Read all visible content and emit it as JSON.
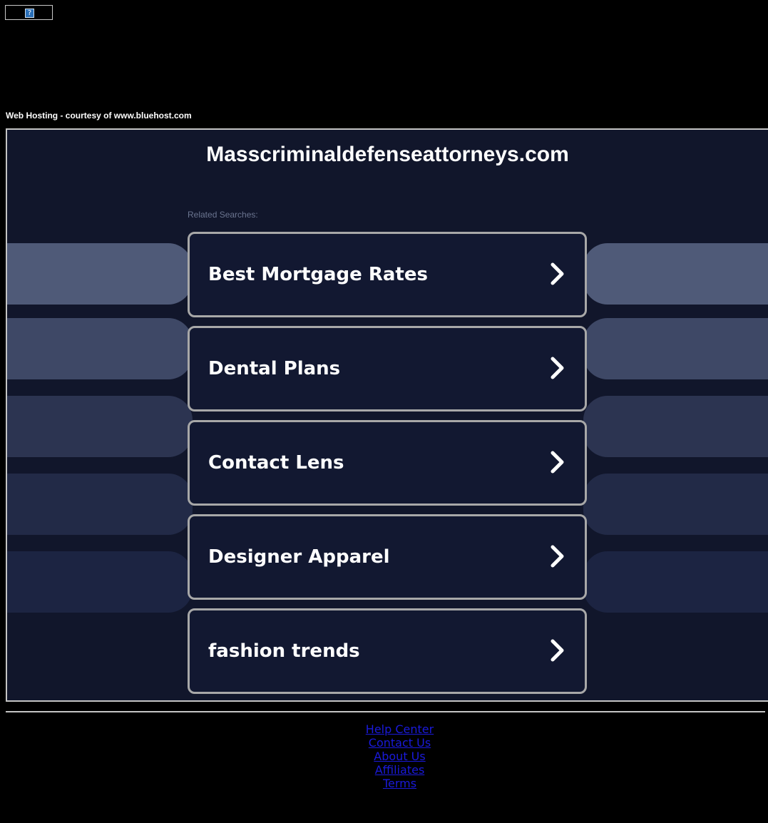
{
  "top_icon": {
    "glyph": "?",
    "name": "broken-image-icon"
  },
  "hosting_text": "Web Hosting - courtesy of www.bluehost.com",
  "site": {
    "title": "Masscriminaldefenseattorneys.com"
  },
  "related_label": "Related Searches:",
  "searches": [
    {
      "label": "Best Mortgage Rates"
    },
    {
      "label": "Dental Plans"
    },
    {
      "label": "Contact Lens"
    },
    {
      "label": "Designer Apparel"
    },
    {
      "label": "fashion trends"
    }
  ],
  "footer_links": [
    {
      "label": "Help Center"
    },
    {
      "label": "Contact Us"
    },
    {
      "label": "About Us"
    },
    {
      "label": "Affiliates"
    },
    {
      "label": "Terms"
    }
  ],
  "colors": {
    "page_bg": "#000000",
    "frame_bg": "#11162b",
    "card_bg": "#121831",
    "card_border": "#a8a8a8",
    "link": "#1a1adb",
    "pill_shades": [
      "#4f5a78",
      "#3e4866",
      "#2c3451",
      "#222a47",
      "#1c2442"
    ]
  }
}
